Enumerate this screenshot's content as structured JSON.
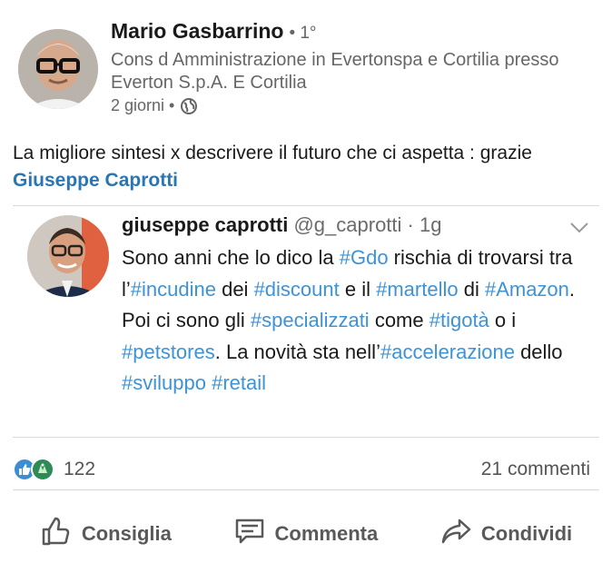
{
  "post": {
    "author": {
      "name": "Mario Gasbarrino",
      "degree": "• 1°",
      "headline": "Cons d Amministrazione in Evertonspa e Cortilia presso Everton S.p.A. E Cortilia",
      "time": "2 giorni •"
    },
    "text_before": "La migliore sintesi x descrivere il futuro che ci aspetta : grazie ",
    "mention": "Giuseppe Caprotti"
  },
  "tweet": {
    "name": "giuseppe caprotti",
    "handle": " @g_caprotti · 1g",
    "body": [
      {
        "t": "Sono anni che lo dico la ",
        "h": false
      },
      {
        "t": "#Gdo",
        "h": true
      },
      {
        "t": " rischia di trovarsi tra l’",
        "h": false
      },
      {
        "t": "#incudine",
        "h": true
      },
      {
        "t": " dei ",
        "h": false
      },
      {
        "t": "#discount",
        "h": true
      },
      {
        "t": " e il ",
        "h": false
      },
      {
        "t": "#martello",
        "h": true
      },
      {
        "t": " di ",
        "h": false
      },
      {
        "t": "#Amazon",
        "h": true
      },
      {
        "t": ". Poi ci sono gli ",
        "h": false
      },
      {
        "t": "#specializzati",
        "h": true
      },
      {
        "t": " come ",
        "h": false
      },
      {
        "t": "#tigotà",
        "h": true
      },
      {
        "t": " o i ",
        "h": false
      },
      {
        "t": "#petstores",
        "h": true
      },
      {
        "t": ". La novità sta nell’",
        "h": false
      },
      {
        "t": "#accelerazione",
        "h": true
      },
      {
        "t": " dello ",
        "h": false
      },
      {
        "t": "#sviluppo",
        "h": true
      },
      {
        "t": " ",
        "h": false
      },
      {
        "t": "#retail",
        "h": true
      }
    ]
  },
  "stats": {
    "reactions": "122",
    "comments": "21 commenti"
  },
  "actions": {
    "like": "Consiglia",
    "comment": "Commenta",
    "share": "Condividi"
  },
  "colors": {
    "hashtag": "#3d93d6",
    "mention": "#2a75b3",
    "like_reaction": "#3b8dd4",
    "celebrate_reaction": "#2e8b57"
  },
  "icons": {
    "visibility": "globe-icon",
    "tweet_menu": "chevron-down-icon",
    "like": "thumbs-up-icon",
    "comment": "comment-icon",
    "share": "share-arrow-icon"
  }
}
